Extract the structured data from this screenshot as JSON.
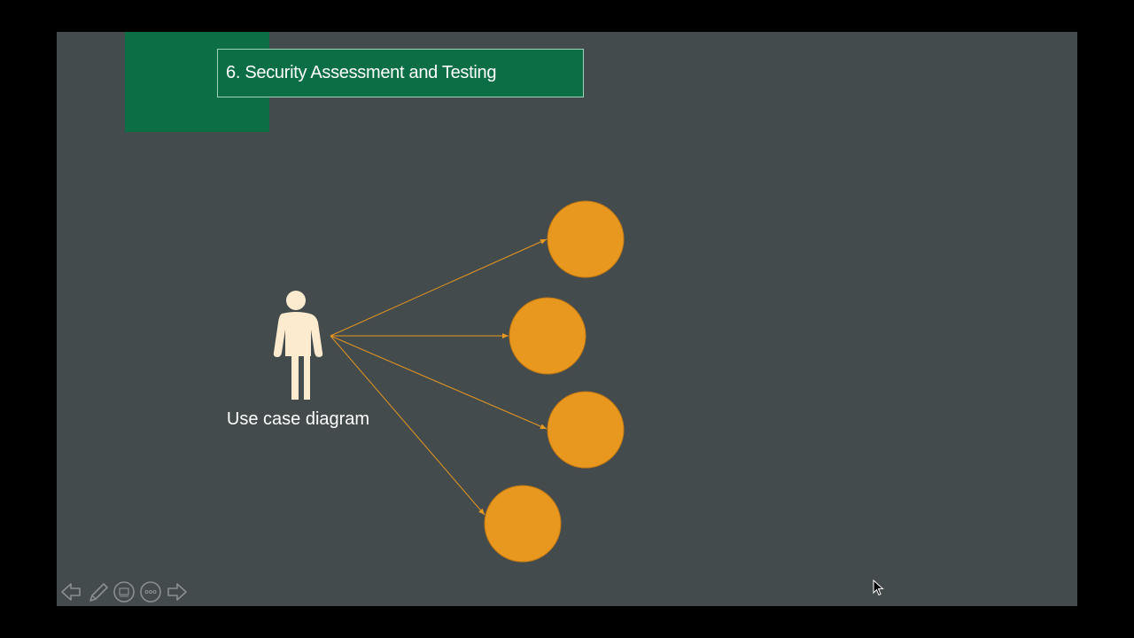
{
  "slide": {
    "title": "6. Security Assessment and Testing",
    "actor_label": "Use case diagram"
  },
  "diagram": {
    "actor_color": "#fdebd0",
    "connector_color": "#e8971f",
    "use_case_color": "#e8971f",
    "use_cases": [
      "",
      "",
      "",
      ""
    ]
  },
  "colors": {
    "slide_background": "#434b4d",
    "title_background": "#0b6e45",
    "accent_green": "#0b6e45"
  },
  "controls": {
    "icons": [
      "arrow-left-icon",
      "pen-icon",
      "slides-grid-icon",
      "more-options-icon",
      "arrow-right-icon"
    ]
  }
}
